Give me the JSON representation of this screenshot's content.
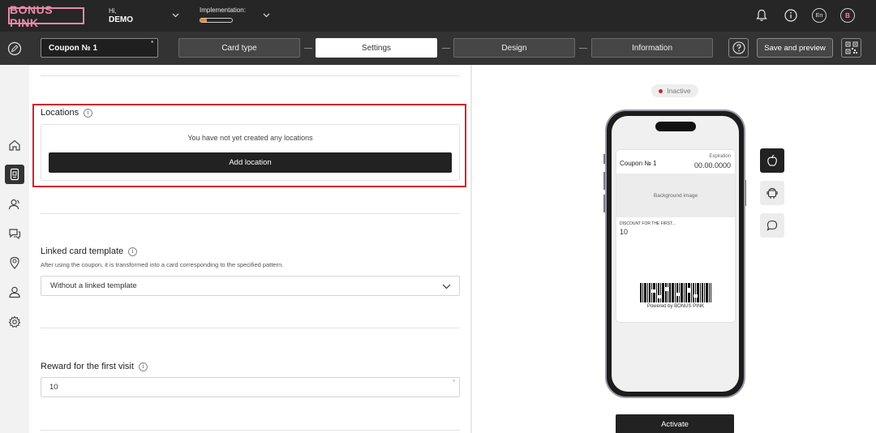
{
  "topbar": {
    "logo": "BONUS PINK",
    "greeting": "Hi,",
    "user_name": "DEMO",
    "implementation_label": "Implementation:",
    "implementation_progress": 0.2,
    "lang": "En",
    "avatar_letter": "B"
  },
  "toolbar": {
    "coupon_name": "Coupon № 1",
    "required_mark": "*",
    "steps": [
      {
        "label": "Card type"
      },
      {
        "label": "Settings"
      },
      {
        "label": "Design"
      },
      {
        "label": "Information"
      }
    ],
    "active_step": "Settings",
    "save_label": "Save and preview"
  },
  "settings": {
    "locations": {
      "title": "Locations",
      "empty_text": "You have not yet created any locations",
      "add_button": "Add location"
    },
    "linked_template": {
      "title": "Linked card template",
      "description": "After using the coupon, it is transformed into a card corresponding to the specified pattern.",
      "selected": "Without a linked template"
    },
    "reward": {
      "title": "Reward for the first visit",
      "value": "10",
      "required_mark": "*"
    }
  },
  "preview": {
    "status": "Inactive",
    "card": {
      "name": "Coupon № 1",
      "expiration_label": "Expiration",
      "expiration_value": "00.00.0000",
      "background_label": "Background image",
      "discount_label": "DISCOUNT FOR THE FIRST...",
      "discount_value": "10",
      "powered_by": "Powered by BONUS PINK"
    },
    "activate_label": "Activate"
  },
  "colors": {
    "brand_pink": "#e98aa8",
    "dark": "#262626",
    "highlight_red": "#d4202b",
    "progress_orange": "#f08a24"
  }
}
